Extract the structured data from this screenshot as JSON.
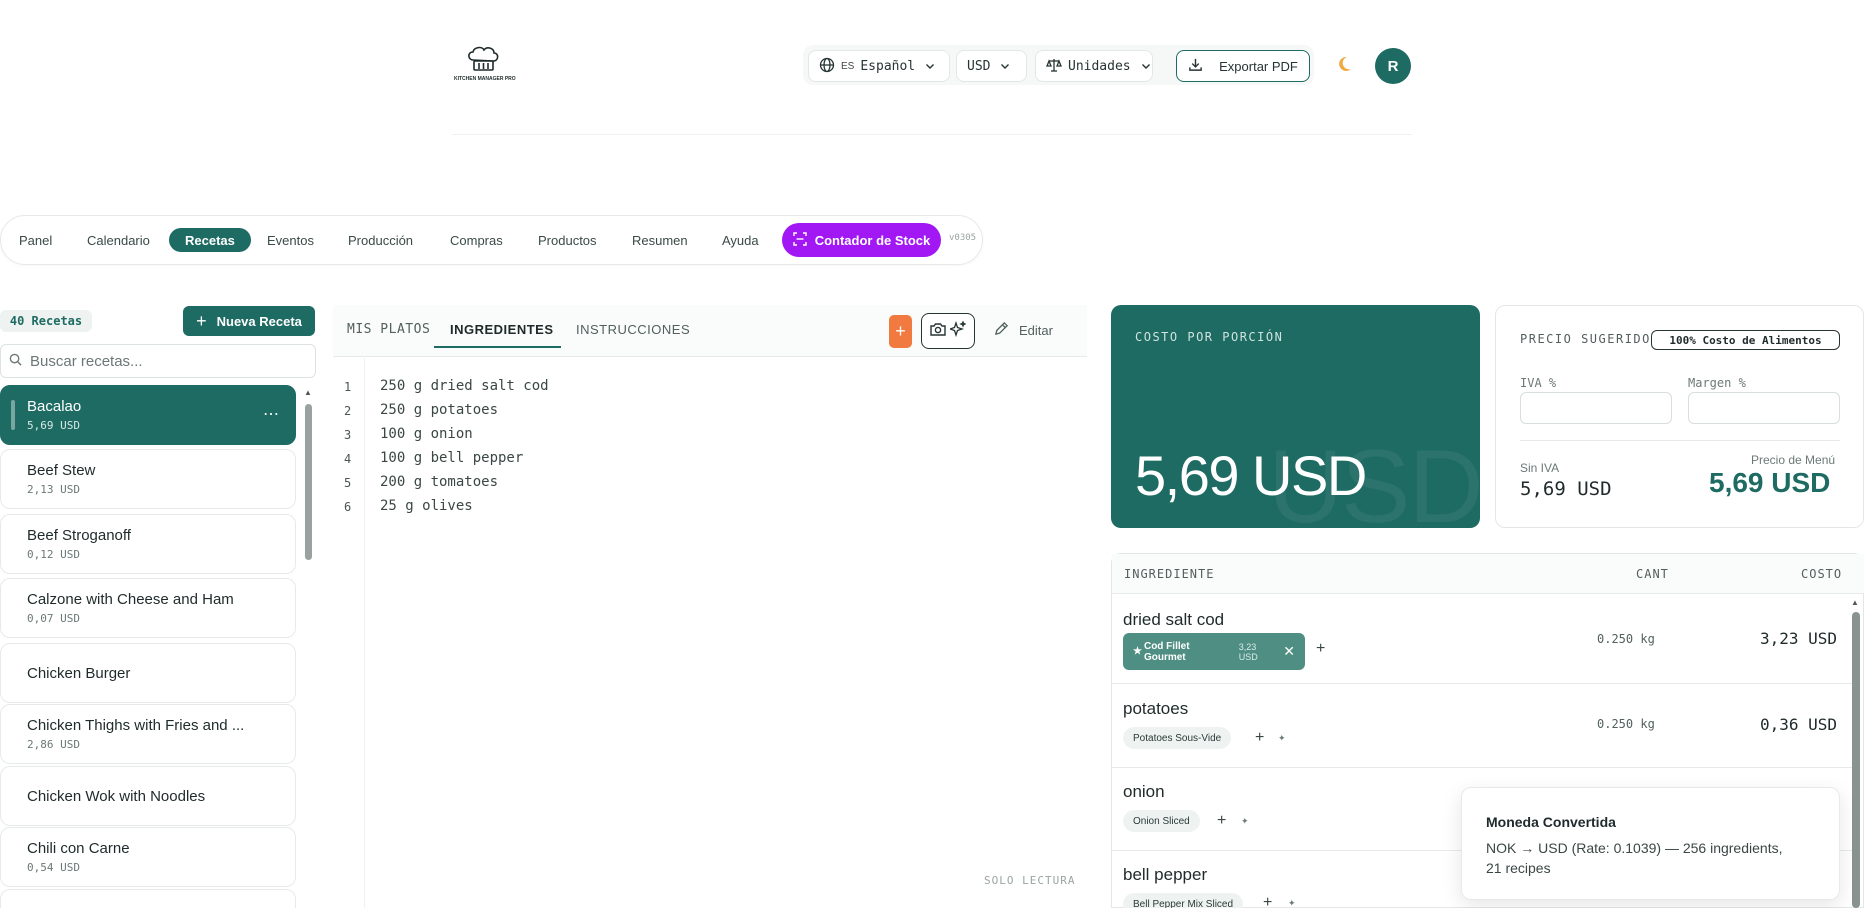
{
  "header": {
    "logo_text": "KITCHEN MANAGER PRO",
    "language": {
      "code": "ES",
      "label": "Español"
    },
    "currency": "USD",
    "units": "Unidades",
    "export_label": "Exportar PDF",
    "theme_icon": "moon-icon",
    "avatar_initial": "R"
  },
  "nav": {
    "items": [
      {
        "label": "Panel"
      },
      {
        "label": "Calendario"
      },
      {
        "label": "Recetas",
        "active": true
      },
      {
        "label": "Eventos"
      },
      {
        "label": "Producción"
      },
      {
        "label": "Compras"
      },
      {
        "label": "Productos"
      },
      {
        "label": "Resumen"
      },
      {
        "label": "Ayuda"
      }
    ],
    "stock_counter_label": "Contador de Stock",
    "version": "v0305"
  },
  "sidebar": {
    "count_label": "40 Recetas",
    "new_recipe_label": "Nueva Receta",
    "search_placeholder": "Buscar recetas...",
    "recipes": [
      {
        "name": "Bacalao",
        "price": "5,69 USD",
        "active": true
      },
      {
        "name": "Beef Stew",
        "price": "2,13 USD"
      },
      {
        "name": "Beef Stroganoff",
        "price": "0,12 USD"
      },
      {
        "name": "Calzone with Cheese and Ham",
        "price": "0,07 USD"
      },
      {
        "name": "Chicken Burger",
        "price": ""
      },
      {
        "name": "Chicken Thighs with Fries and ...",
        "price": "2,86 USD"
      },
      {
        "name": "Chicken Wok with Noodles",
        "price": ""
      },
      {
        "name": "Chili con Carne",
        "price": "0,54 USD"
      }
    ]
  },
  "editor": {
    "tabs": [
      {
        "label": "MIS PLATOS"
      },
      {
        "label": "INGREDIENTES",
        "active": true
      },
      {
        "label": "INSTRUCCIONES"
      }
    ],
    "edit_label": "Editar",
    "lines": [
      {
        "no": "1",
        "text": "250 g dried salt cod"
      },
      {
        "no": "2",
        "text": "250 g potatoes"
      },
      {
        "no": "3",
        "text": "100 g onion"
      },
      {
        "no": "4",
        "text": "100 g bell pepper"
      },
      {
        "no": "5",
        "text": "200 g tomatoes"
      },
      {
        "no": "6",
        "text": "25 g olives"
      }
    ],
    "readonly_label": "SOLO LECTURA"
  },
  "cost_card": {
    "label": "COSTO POR PORCIÓN",
    "value": "5,69 USD",
    "watermark": "USD",
    "color": "#1e6b63"
  },
  "price_card": {
    "label": "PRECIO SUGERIDO",
    "badge": "100% Costo de Alimentos",
    "vat_label": "IVA %",
    "margin_label": "Margen %",
    "no_vat_label": "Sin IVA",
    "no_vat_value": "5,69 USD",
    "menu_price_label": "Precio de Menú",
    "menu_price_value": "5,69 USD"
  },
  "ingredients_table": {
    "headers": {
      "ingredient": "INGREDIENTE",
      "qty": "CANT",
      "cost": "COSTO"
    },
    "rows": [
      {
        "name": "dried salt cod",
        "product": "Cod Fillet Gourmet",
        "product_price": "3,23 USD",
        "qty": "0.250 kg",
        "cost": "3,23 USD"
      },
      {
        "name": "potatoes",
        "product": "Potatoes Sous-Vide",
        "qty": "0.250 kg",
        "cost": "0,36 USD"
      },
      {
        "name": "onion",
        "product": "Onion Sliced"
      },
      {
        "name": "bell pepper",
        "product": "Bell Pepper Mix Sliced"
      }
    ]
  },
  "toast": {
    "title": "Moneda Convertida",
    "line1": "NOK → USD (Rate: 0.1039) — 256 ingredients,",
    "line2": "21 recipes"
  },
  "colors": {
    "brand": "#1e6b63",
    "stock_button": "#a218f5",
    "add_button": "#f07a40"
  }
}
